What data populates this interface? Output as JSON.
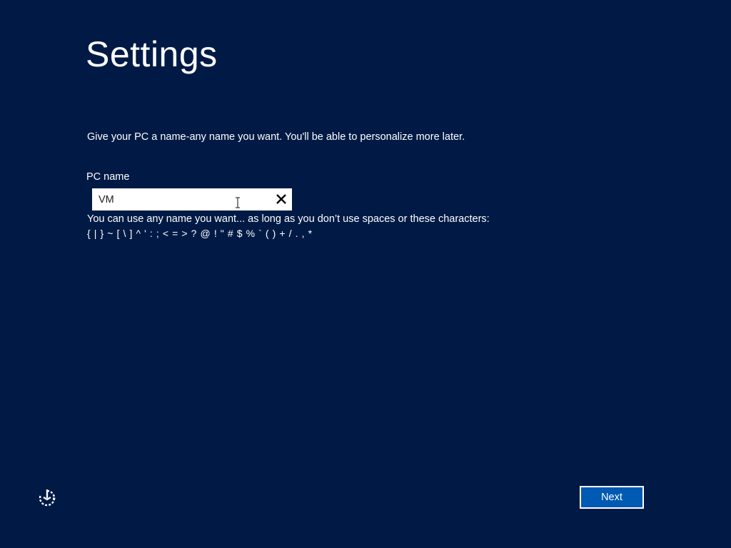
{
  "page": {
    "title": "Settings",
    "intro": "Give your PC a name-any name you want. You'll be able to personalize more later."
  },
  "pc_name": {
    "label": "PC name",
    "value": "VM",
    "hint": "You can use any name you want... as long as you don’t use spaces or these characters:",
    "forbidden_chars": "{ | } ~ [ \\ ] ^ ' : ; < = > ? @ ! \" # $ % ` ( ) + / . , *"
  },
  "footer": {
    "next_label": "Next",
    "accessibility_icon": "ease-of-access-icon"
  },
  "colors": {
    "background": "#011a45",
    "next_button": "#0059b3",
    "text": "#ffffff"
  }
}
